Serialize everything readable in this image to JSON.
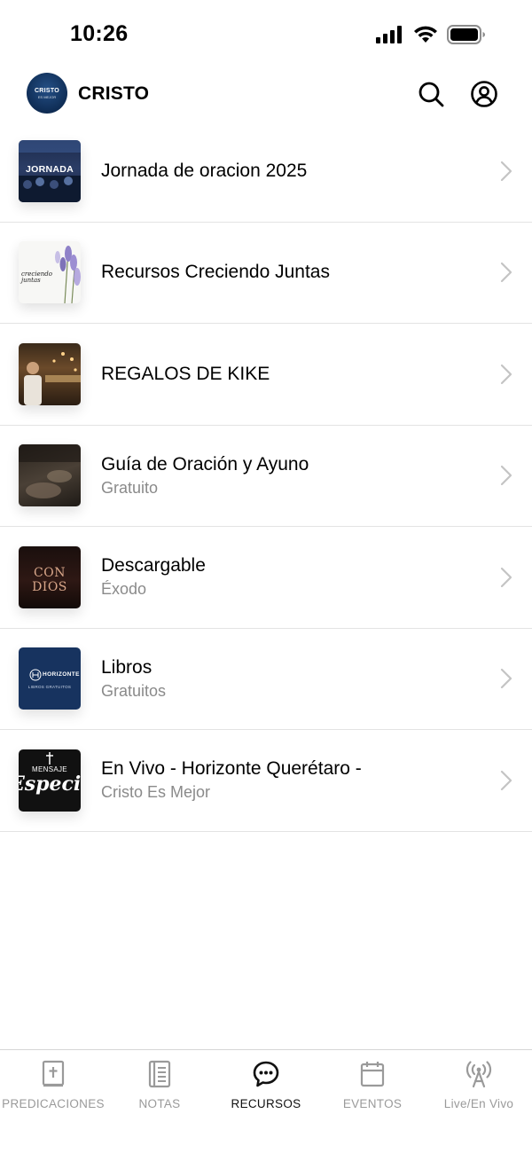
{
  "status": {
    "time": "10:26"
  },
  "header": {
    "logo_line1": "CRISTO",
    "logo_line2": "ES MEJOR",
    "title": "CRISTO",
    "search_icon": "search-icon",
    "profile_icon": "profile-icon"
  },
  "resources": [
    {
      "title": "Jornada de oracion 2025",
      "subtitle": "",
      "thumb_text": "JORNADA",
      "thumb": "jornada"
    },
    {
      "title": "Recursos Creciendo Juntas",
      "subtitle": "",
      "thumb_text": "creciendo juntas",
      "thumb": "creciendo"
    },
    {
      "title": "REGALOS DE KIKE",
      "subtitle": "",
      "thumb_text": "",
      "thumb": "kike"
    },
    {
      "title": "Guía de Oración y Ayuno",
      "subtitle": "Gratuito",
      "thumb_text": "",
      "thumb": "guia"
    },
    {
      "title": "Descargable",
      "subtitle": "Éxodo",
      "thumb_text": "CON DIOS",
      "thumb": "exodo"
    },
    {
      "title": "Libros",
      "subtitle": "Gratuitos",
      "thumb_text": "HORIZONTE",
      "thumb_text2": "LIBROS GRATUITOS",
      "thumb": "libros"
    },
    {
      "title": "En Vivo - Horizonte Querétaro -",
      "subtitle": "Cristo Es Mejor",
      "thumb_text": "MENSAJE",
      "thumb_text2": "Especial",
      "thumb": "envivo"
    }
  ],
  "tabs": [
    {
      "label": "PREDICACIONES",
      "icon": "bible-icon",
      "active": false
    },
    {
      "label": "NOTAS",
      "icon": "notebook-icon",
      "active": false
    },
    {
      "label": "RECURSOS",
      "icon": "chat-bubble-icon",
      "active": true
    },
    {
      "label": "EVENTOS",
      "icon": "calendar-icon",
      "active": false
    },
    {
      "label": "Live/En Vivo",
      "icon": "broadcast-icon",
      "active": false
    }
  ],
  "colors": {
    "accent": "#111111",
    "inactive": "#9a9a9a",
    "divider": "#e3e3e3",
    "brand": "#0f2d55"
  }
}
